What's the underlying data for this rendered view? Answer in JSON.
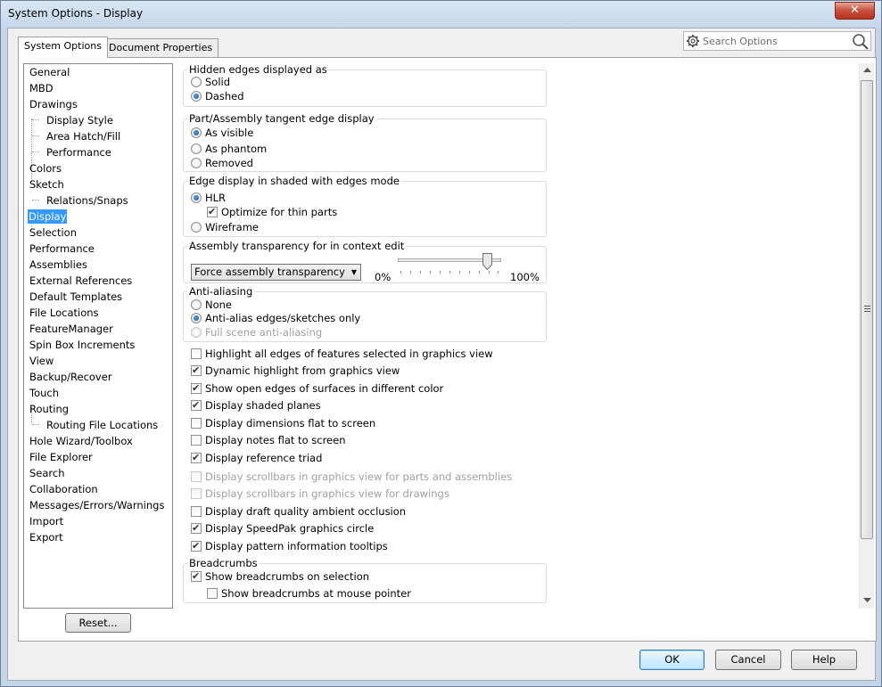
{
  "window": {
    "title": "System Options - Display",
    "close_label": "✕"
  },
  "tabs": [
    {
      "label": "System Options"
    },
    {
      "label": "Document Properties"
    }
  ],
  "search": {
    "placeholder": "Search Options"
  },
  "tree": {
    "items": [
      {
        "label": "General"
      },
      {
        "label": "MBD"
      },
      {
        "label": "Drawings"
      },
      {
        "label": "Display Style"
      },
      {
        "label": "Area Hatch/Fill"
      },
      {
        "label": "Performance"
      },
      {
        "label": "Colors"
      },
      {
        "label": "Sketch"
      },
      {
        "label": "Relations/Snaps"
      },
      {
        "label": "Display"
      },
      {
        "label": "Selection"
      },
      {
        "label": "Performance"
      },
      {
        "label": "Assemblies"
      },
      {
        "label": "External References"
      },
      {
        "label": "Default Templates"
      },
      {
        "label": "File Locations"
      },
      {
        "label": "FeatureManager"
      },
      {
        "label": "Spin Box Increments"
      },
      {
        "label": "View"
      },
      {
        "label": "Backup/Recover"
      },
      {
        "label": "Touch"
      },
      {
        "label": "Routing"
      },
      {
        "label": "Routing File Locations"
      },
      {
        "label": "Hole Wizard/Toolbox"
      },
      {
        "label": "File Explorer"
      },
      {
        "label": "Search"
      },
      {
        "label": "Collaboration"
      },
      {
        "label": "Messages/Errors/Warnings"
      },
      {
        "label": "Import"
      },
      {
        "label": "Export"
      }
    ],
    "selected": "Display"
  },
  "groups": {
    "hidden_edges": {
      "title": "Hidden edges displayed as",
      "opt1": "Solid",
      "opt2": "Dashed"
    },
    "tangent": {
      "title": "Part/Assembly tangent edge display",
      "opt1": "As visible",
      "opt2": "As phantom",
      "opt3": "Removed"
    },
    "shaded": {
      "title": "Edge display in shaded with edges mode",
      "opt1": "HLR",
      "opt1_sub": "Optimize for thin parts",
      "opt2": "Wireframe"
    },
    "transparency": {
      "title": "Assembly transparency for in context edit",
      "select_value": "Force assembly transparency",
      "min_label": "0%",
      "max_label": "100%",
      "slider_percent": 90
    },
    "antialias": {
      "title": "Anti-aliasing",
      "opt1": "None",
      "opt2": "Anti-alias edges/sketches only",
      "opt3": "Full scene anti-aliasing"
    },
    "breadcrumbs": {
      "title": "Breadcrumbs",
      "opt1": "Show breadcrumbs on selection",
      "opt2": "Show breadcrumbs at mouse pointer"
    }
  },
  "checkboxes": [
    {
      "label": "Highlight all edges of features selected in graphics view",
      "checked": false
    },
    {
      "label": "Dynamic highlight from graphics view",
      "checked": true
    },
    {
      "label": "Show open edges of surfaces in different color",
      "checked": true
    },
    {
      "label": "Display shaded planes",
      "checked": true
    },
    {
      "label": "Display dimensions flat to screen",
      "checked": false
    },
    {
      "label": "Display notes flat to screen",
      "checked": false
    },
    {
      "label": "Display reference triad",
      "checked": true
    },
    {
      "label": "Display scrollbars in graphics view for parts and assemblies",
      "checked": false
    },
    {
      "label": "Display scrollbars in graphics view for drawings",
      "checked": false
    },
    {
      "label": "Display draft quality ambient occlusion",
      "checked": false
    },
    {
      "label": "Display SpeedPak graphics circle",
      "checked": true
    },
    {
      "label": "Display pattern information tooltips",
      "checked": true
    }
  ],
  "buttons": {
    "reset": "Reset...",
    "ok": "OK",
    "cancel": "Cancel",
    "help": "Help"
  }
}
